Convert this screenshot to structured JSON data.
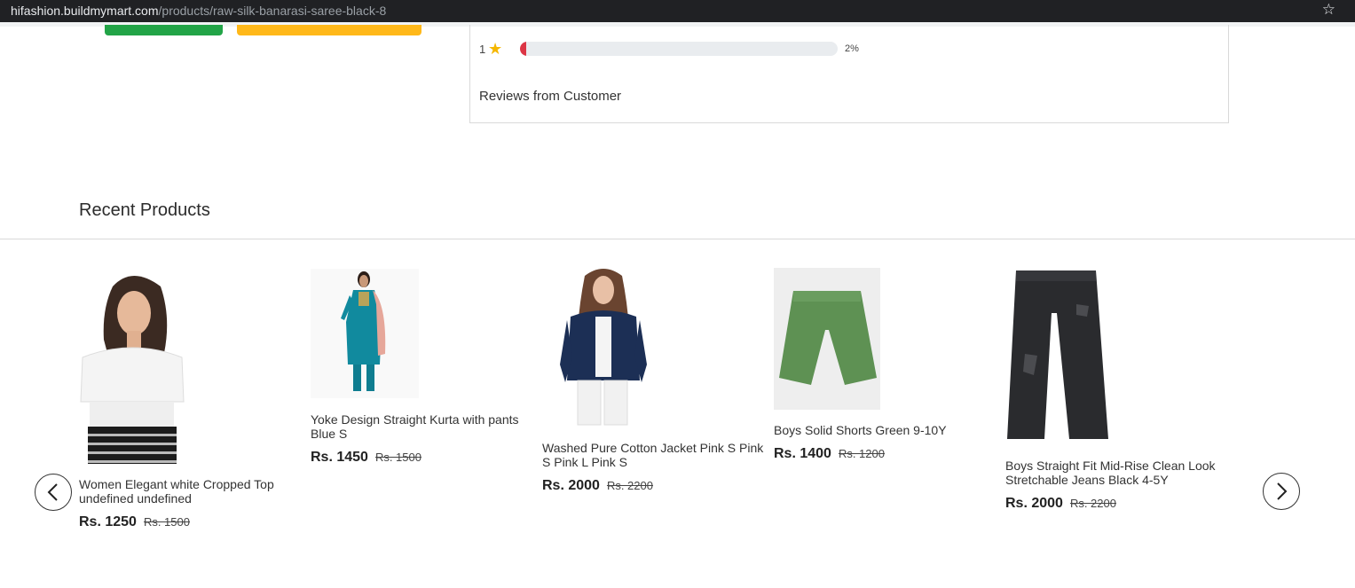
{
  "browser": {
    "url_host": "hifashion.buildmymart.com",
    "url_path": "/products/raw-silk-banarasi-saree-black-8"
  },
  "rating": {
    "stars": "1",
    "percent_label": "2%",
    "percent_value": 2,
    "bar_color": "#dc3545"
  },
  "reviews": {
    "title": "Reviews from Customer"
  },
  "recent": {
    "title": "Recent Products",
    "products": [
      {
        "name": "Women Elegant white Cropped Top undefined undefined",
        "price": "Rs. 1250",
        "old_price": "Rs. 1500"
      },
      {
        "name": "Yoke Design Straight Kurta with pants Blue S",
        "price": "Rs. 1450",
        "old_price": "Rs. 1500"
      },
      {
        "name": "Washed Pure Cotton Jacket Pink S Pink S Pink L Pink S",
        "price": "Rs. 2000",
        "old_price": "Rs. 2200"
      },
      {
        "name": "Boys Solid Shorts Green 9-10Y",
        "price": "Rs. 1400",
        "old_price": "Rs. 1200"
      },
      {
        "name": "Boys Straight Fit Mid-Rise Clean Look Stretchable Jeans Black 4-5Y",
        "price": "Rs. 2000",
        "old_price": "Rs. 2200"
      }
    ]
  },
  "colors": {
    "buy_button": "#22a447",
    "cart_button": "#ffb819",
    "star": "#f5b700"
  },
  "icons": {
    "star": "star-icon",
    "bookmark": "bookmark-star-icon",
    "prev": "chevron-left-icon",
    "next": "chevron-right-icon"
  }
}
